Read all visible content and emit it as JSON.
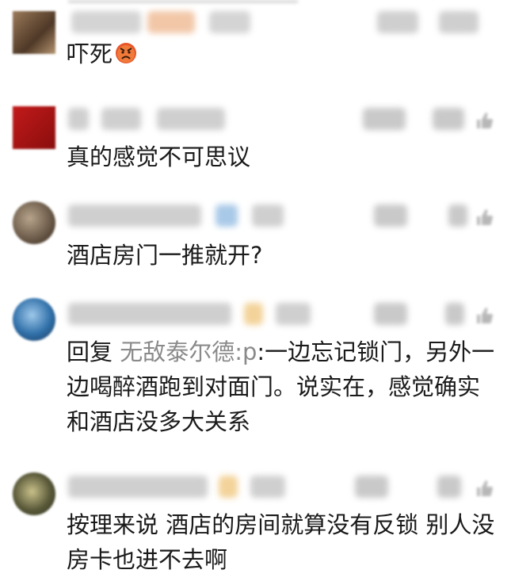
{
  "comments": [
    {
      "text": "吓死",
      "emoji": "angry-face-emoji"
    },
    {
      "text": "真的感觉不可思议"
    },
    {
      "text": "酒店房门一推就开?"
    },
    {
      "reply_prefix": "回复 ",
      "mention": "无敌泰尔德:p",
      "text": ":一边忘记锁门，另外一边喝醉酒跑到对面门。说实在，感觉确实和酒店没多大关系"
    },
    {
      "text": "按理来说 酒店的房间就算没有反锁 别人没房卡也进不去啊"
    }
  ],
  "colors": {
    "mention": "#8a8a8a",
    "text": "#1a1a1a",
    "redacted": "#cfcfcf"
  }
}
